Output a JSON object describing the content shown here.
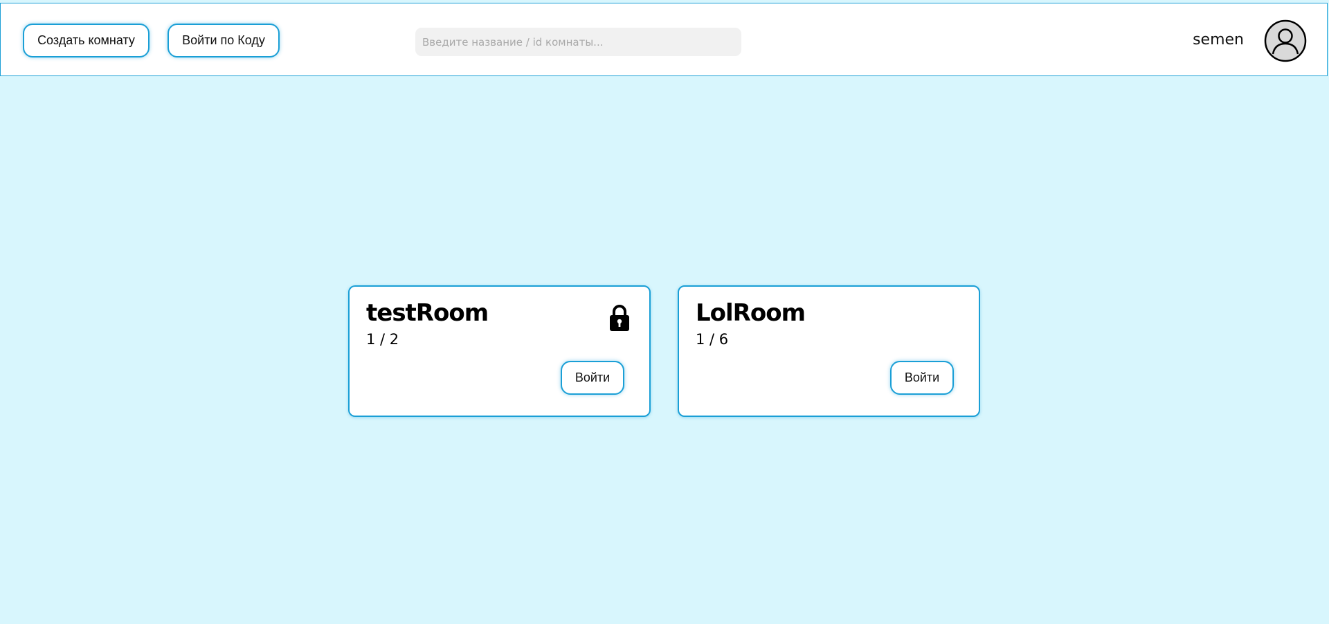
{
  "header": {
    "create_room_label": "Создать комнату",
    "join_by_code_label": "Войти по Коду",
    "search_placeholder": "Введите название / id комнаты...",
    "search_value": "",
    "username": "semen",
    "avatar_icon": "user-circle-icon"
  },
  "rooms": [
    {
      "name": "testRoom",
      "players": "1 / 2",
      "locked": true,
      "lock_icon": "lock-icon",
      "enter_label": "Войти"
    },
    {
      "name": "LolRoom",
      "players": "1 / 6",
      "locked": false,
      "enter_label": "Войти"
    }
  ],
  "colors": {
    "page_background": "#d8f6fd",
    "accent": "#1a9fd6",
    "search_background": "#f1f1f1"
  }
}
